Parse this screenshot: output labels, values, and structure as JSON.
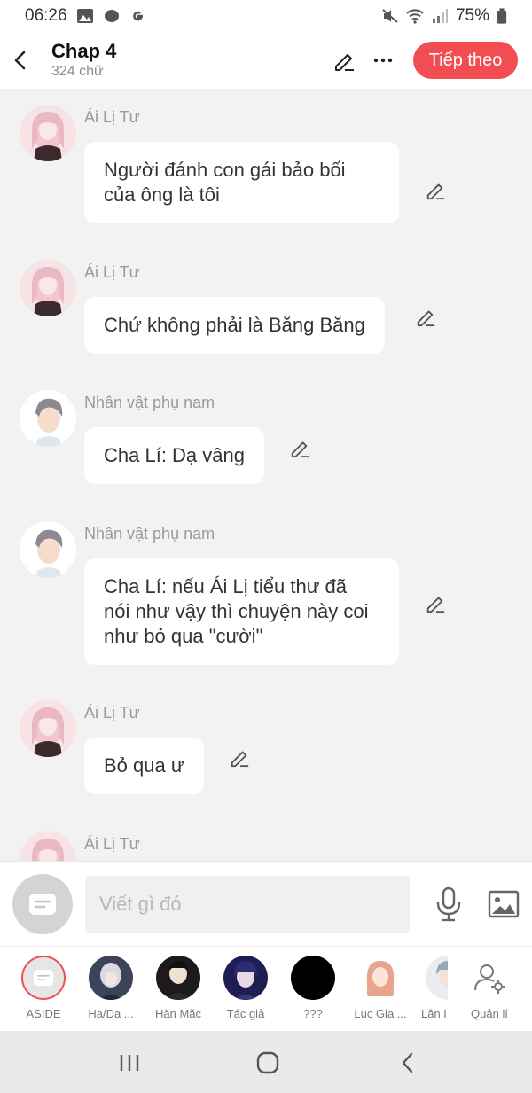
{
  "status": {
    "time": "06:26",
    "battery": "75%"
  },
  "header": {
    "title": "Chap 4",
    "subtitle": "324 chữ",
    "next_label": "Tiếp theo"
  },
  "messages": [
    {
      "name": "Ái Lị Tư",
      "text": "Người đánh con gái bảo bối\ncủa ông là tôi",
      "avatar": "pink-hair-girl"
    },
    {
      "name": "Ái Lị Tư",
      "text": "Chứ không phải là Băng Băng",
      "avatar": "pink-hair-girl"
    },
    {
      "name": "Nhân vật phụ nam",
      "text": "Cha Lí: Dạ vâng",
      "avatar": "gray-hair-man"
    },
    {
      "name": "Nhân vật phụ nam",
      "text": "Cha Lí: nếu Ái Lị tiểu thư đã\nnói như vậy thì chuyện này coi\nnhư bỏ qua \"cười\"",
      "avatar": "gray-hair-man"
    },
    {
      "name": "Ái Lị Tư",
      "text": "Bỏ qua ư",
      "avatar": "pink-hair-girl"
    },
    {
      "name": "Ái Lị Tư",
      "text": "",
      "avatar": "pink-hair-girl"
    }
  ],
  "input": {
    "placeholder": "Viết gì đó"
  },
  "characters": [
    {
      "label": "ASIDE"
    },
    {
      "label": "Hạ/Dạ ..."
    },
    {
      "label": "Hàn Mặc"
    },
    {
      "label": "Tác giả"
    },
    {
      "label": "???"
    },
    {
      "label": "Lục Gia ..."
    },
    {
      "label": "Lân I"
    },
    {
      "label": "Quản lí"
    }
  ],
  "colors": {
    "accent": "#f24d52",
    "background": "#f2f2f2"
  }
}
